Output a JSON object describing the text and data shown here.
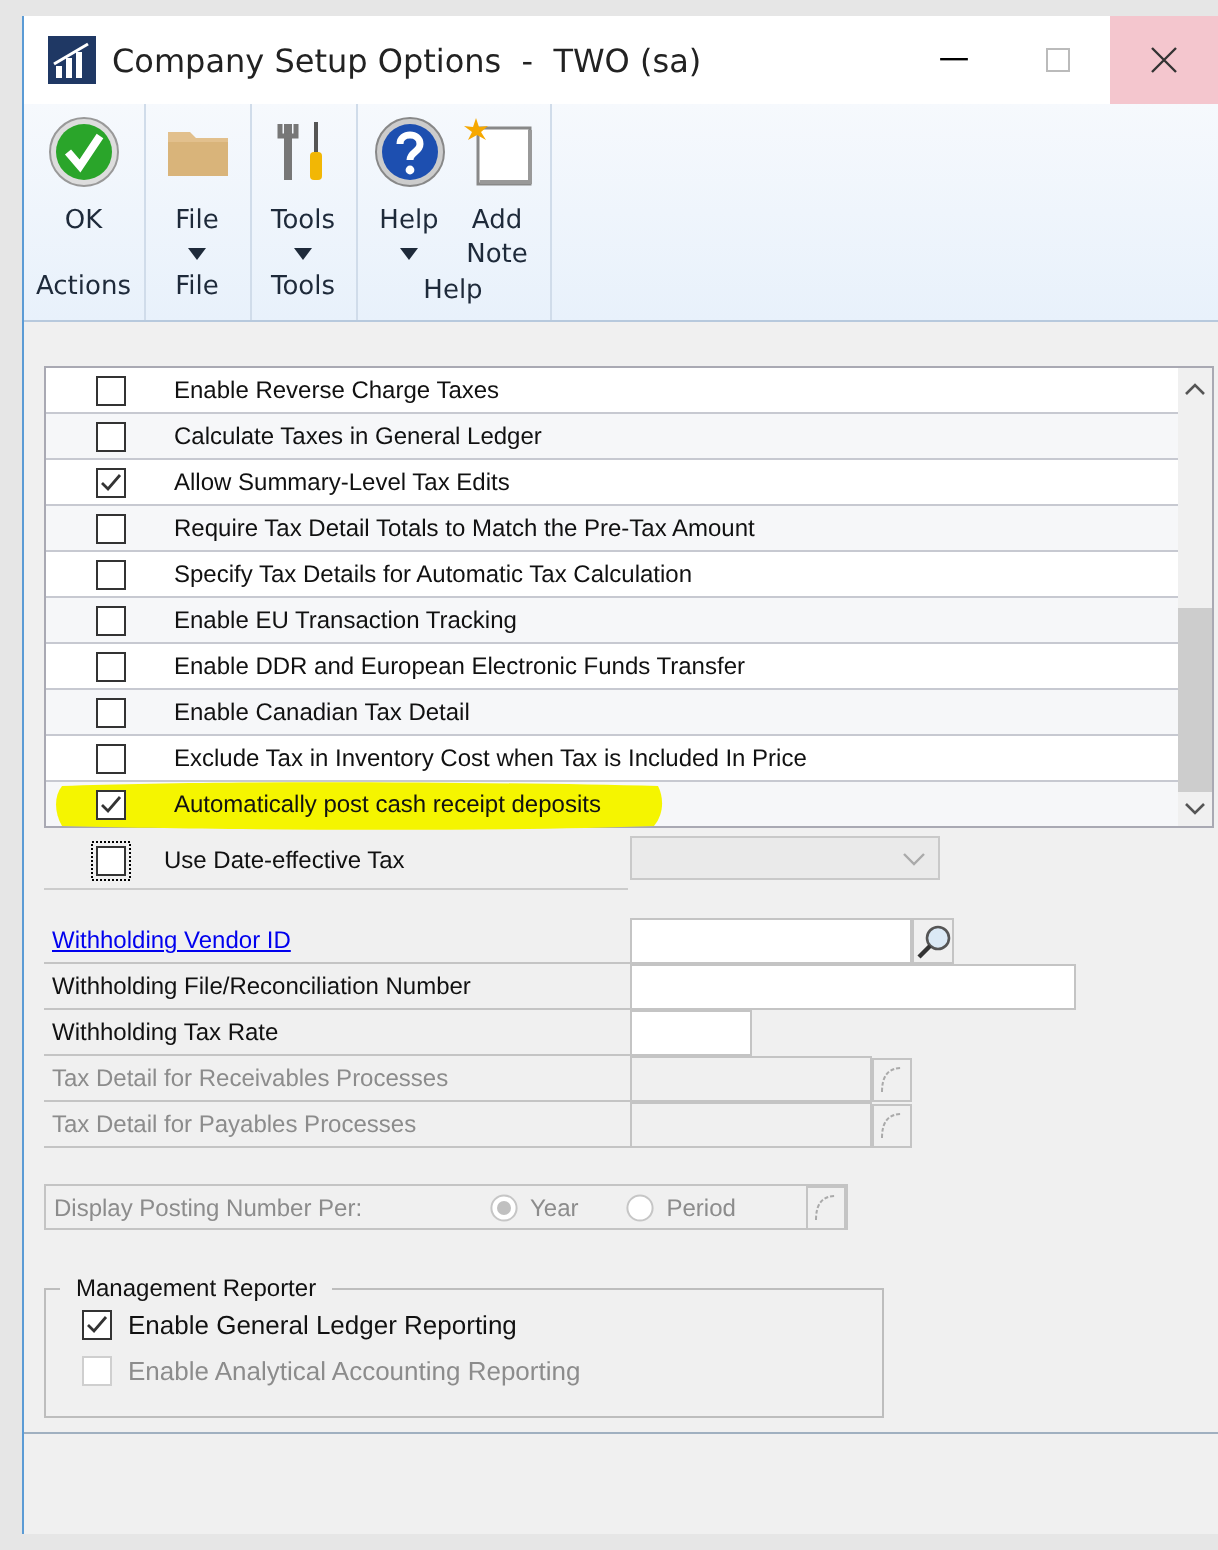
{
  "window": {
    "title": "Company Setup Options  -  TWO (sa)"
  },
  "ribbon": {
    "groups": [
      {
        "label": "Actions",
        "buttons": [
          {
            "label": "OK",
            "kind": "ok",
            "dropdown": false
          }
        ]
      },
      {
        "label": "File",
        "buttons": [
          {
            "label": "File",
            "kind": "file",
            "dropdown": true
          }
        ]
      },
      {
        "label": "Tools",
        "buttons": [
          {
            "label": "Tools",
            "kind": "tools",
            "dropdown": true
          }
        ]
      },
      {
        "label": "Help",
        "buttons": [
          {
            "label": "Help",
            "kind": "help",
            "dropdown": true
          },
          {
            "label": "Add Note",
            "kind": "note",
            "dropdown": false
          }
        ]
      }
    ]
  },
  "options": [
    {
      "label": "Enable Reverse Charge Taxes",
      "checked": false,
      "highlighted": false
    },
    {
      "label": "Calculate Taxes in General Ledger",
      "checked": false,
      "highlighted": false
    },
    {
      "label": "Allow Summary-Level Tax Edits",
      "checked": true,
      "highlighted": false
    },
    {
      "label": "Require Tax Detail Totals to Match the Pre-Tax Amount",
      "checked": false,
      "highlighted": false
    },
    {
      "label": "Specify Tax Details for Automatic Tax Calculation",
      "checked": false,
      "highlighted": false
    },
    {
      "label": "Enable EU Transaction Tracking",
      "checked": false,
      "highlighted": false
    },
    {
      "label": "Enable DDR and European Electronic Funds Transfer",
      "checked": false,
      "highlighted": false
    },
    {
      "label": "Enable Canadian Tax Detail",
      "checked": false,
      "highlighted": false
    },
    {
      "label": "Exclude Tax in Inventory Cost when Tax is Included In Price",
      "checked": false,
      "highlighted": false
    },
    {
      "label": "Automatically post cash receipt deposits",
      "checked": true,
      "highlighted": true
    }
  ],
  "date_effective": {
    "label": "Use Date-effective Tax",
    "checked": false
  },
  "fields": [
    {
      "label": "Withholding Vendor ID",
      "kind": "id",
      "link": true,
      "disabled": false
    },
    {
      "label": "Withholding File/Reconciliation Number",
      "kind": "long",
      "link": false,
      "disabled": false
    },
    {
      "label": "Withholding Tax Rate",
      "kind": "rate",
      "link": false,
      "disabled": false
    },
    {
      "label": "Tax Detail for Receivables Processes",
      "kind": "detail",
      "link": false,
      "disabled": true
    },
    {
      "label": "Tax Detail for Payables Processes",
      "kind": "detail",
      "link": false,
      "disabled": true
    }
  ],
  "posting": {
    "label": "Display Posting Number Per:",
    "disabled": true,
    "options": [
      {
        "label": "Year",
        "selected": true
      },
      {
        "label": "Period",
        "selected": false
      }
    ]
  },
  "management_reporter": {
    "title": "Management Reporter",
    "items": [
      {
        "label": "Enable General Ledger Reporting",
        "checked": true,
        "disabled": false
      },
      {
        "label": "Enable Analytical Accounting Reporting",
        "checked": false,
        "disabled": true
      }
    ]
  }
}
